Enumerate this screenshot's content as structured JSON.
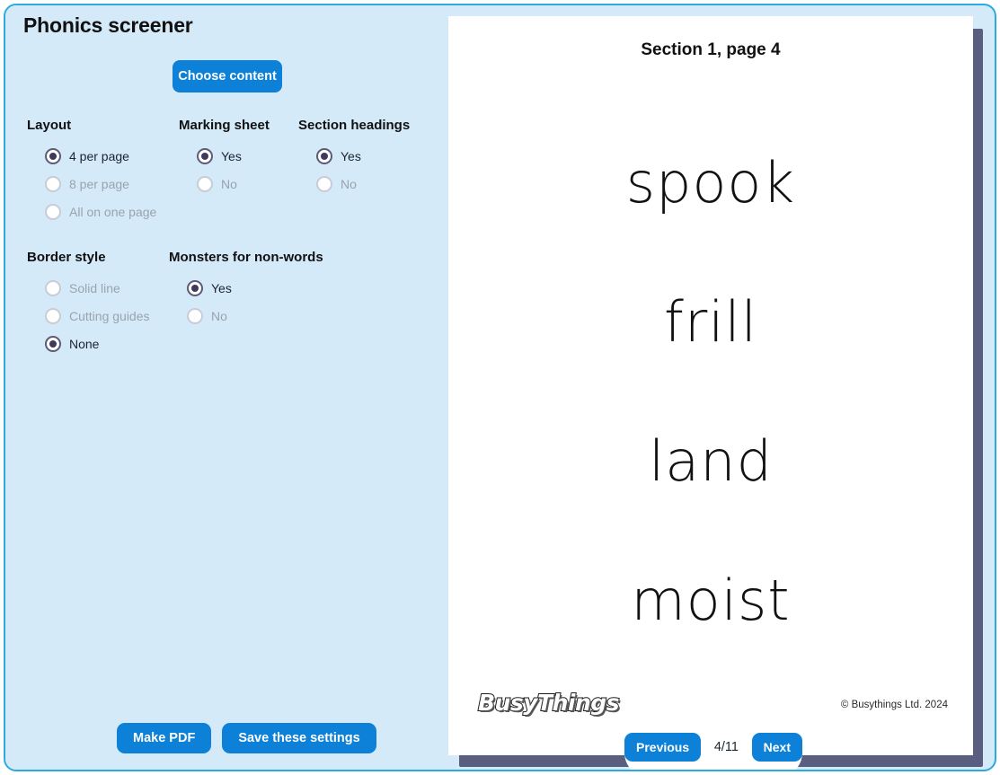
{
  "app": {
    "title": "Phonics screener",
    "accent_blue": "#0d80d8",
    "panel_blue": "#d5eaf9",
    "frame_border": "#29abe2"
  },
  "settings": {
    "choose_content_label": "Choose content",
    "groups": [
      {
        "key": "layout",
        "title": "Layout",
        "options": [
          {
            "label": "4 per page",
            "selected": true
          },
          {
            "label": "8 per page",
            "selected": false
          },
          {
            "label": "All on one page",
            "selected": false
          }
        ]
      },
      {
        "key": "marking_sheet",
        "title": "Marking sheet",
        "options": [
          {
            "label": "Yes",
            "selected": true
          },
          {
            "label": "No",
            "selected": false
          }
        ]
      },
      {
        "key": "section_headings",
        "title": "Section headings",
        "options": [
          {
            "label": "Yes",
            "selected": true
          },
          {
            "label": "No",
            "selected": false
          }
        ]
      },
      {
        "key": "border_style",
        "title": "Border style",
        "options": [
          {
            "label": "Solid line",
            "selected": false
          },
          {
            "label": "Cutting guides",
            "selected": false
          },
          {
            "label": "None",
            "selected": true
          }
        ]
      },
      {
        "key": "monsters_for_non_words",
        "title": "Monsters for non-words",
        "options": [
          {
            "label": "Yes",
            "selected": true
          },
          {
            "label": "No",
            "selected": false
          }
        ]
      }
    ],
    "actions": {
      "make_pdf_label": "Make PDF",
      "save_settings_label": "Save these settings"
    }
  },
  "preview": {
    "section_heading": "Section 1, page 4",
    "words": [
      "spook",
      "frill",
      "land",
      "moist"
    ],
    "logo_text": "BusyThings",
    "copyright": "© Busythings Ltd. 2024",
    "nav": {
      "previous_label": "Previous",
      "page_indicator": "4/11",
      "next_label": "Next"
    }
  }
}
